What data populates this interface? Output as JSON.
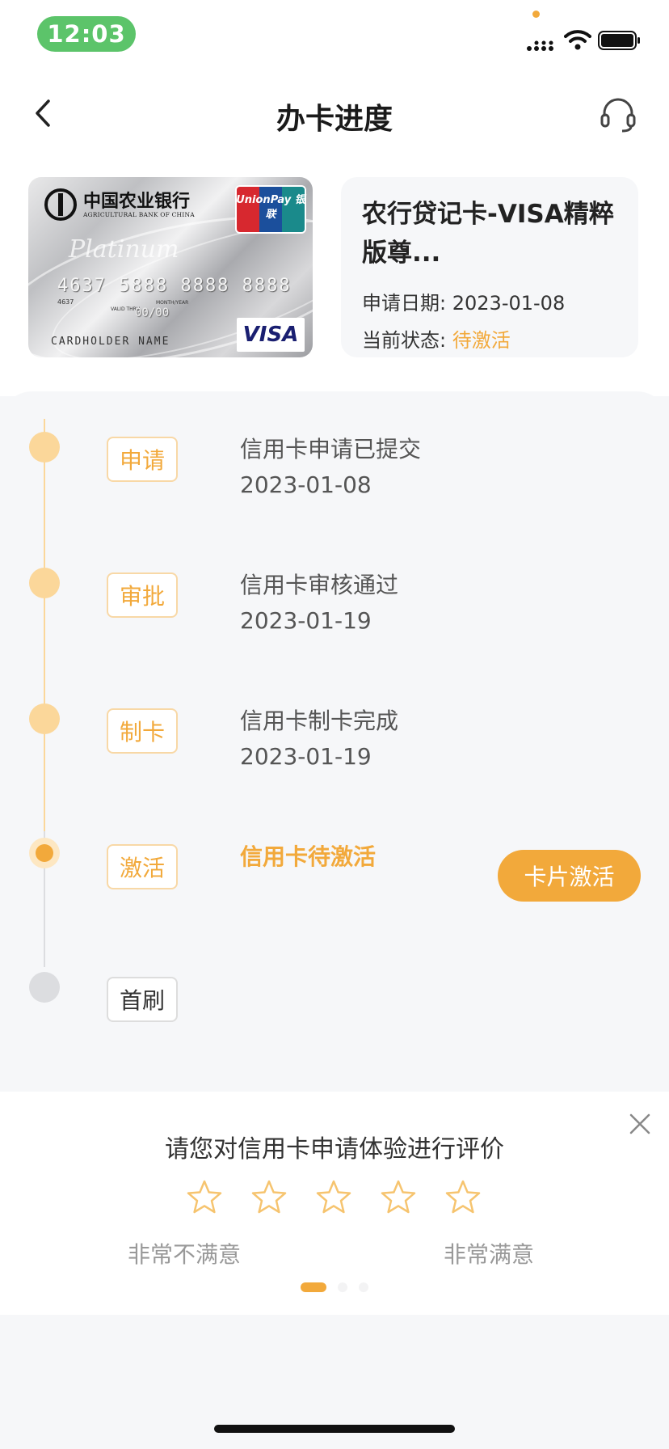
{
  "status_bar": {
    "time": "12:03"
  },
  "nav": {
    "title": "办卡进度"
  },
  "card": {
    "bank_name_cn": "中国农业银行",
    "bank_name_en": "AGRICULTURAL BANK OF CHINA",
    "unionpay_text": "UnionPay 银联",
    "platinum": "Platinum",
    "number": "4637 5888 8888 8888",
    "small_number": "4637",
    "valid_label": "VALID THRU",
    "month_year_label": "MONTH/YEAR",
    "valid": "00/00",
    "holder": "CARDHOLDER NAME",
    "visa": "VISA",
    "title": "农行贷记卡-VISA精粹版尊...",
    "apply_date_label": "申请日期:",
    "apply_date": "2023-01-08",
    "status_label": "当前状态:",
    "status_value": "待激活"
  },
  "timeline": [
    {
      "tag": "申请",
      "text": "信用卡申请已提交",
      "date": "2023-01-08"
    },
    {
      "tag": "审批",
      "text": "信用卡审核通过",
      "date": "2023-01-19"
    },
    {
      "tag": "制卡",
      "text": "信用卡制卡完成",
      "date": "2023-01-19"
    },
    {
      "tag": "激活",
      "text": "信用卡待激活",
      "date": ""
    },
    {
      "tag": "首刷",
      "text": "",
      "date": ""
    }
  ],
  "activate_button": "卡片激活",
  "rating": {
    "title": "请您对信用卡申请体验进行评价",
    "low_label": "非常不满意",
    "high_label": "非常满意",
    "stars": 5,
    "selected": 0
  },
  "colors": {
    "accent": "#f2a93b",
    "accent_light": "#fbd79a",
    "status_green": "#5cc46a"
  }
}
